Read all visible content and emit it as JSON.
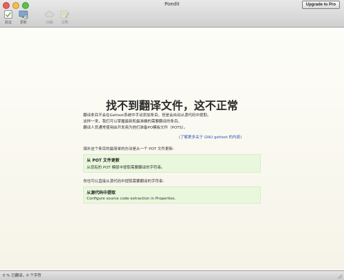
{
  "window": {
    "title": "Poedit",
    "upgrade_label": "Upgrade to Pro"
  },
  "toolbar": {
    "items": [
      {
        "label": "验证",
        "icon": "validate-icon",
        "enabled": true
      },
      {
        "label": "更新",
        "icon": "update-icon",
        "enabled": true
      },
      {
        "label": "同期",
        "icon": "cloud-sync-icon",
        "enabled": false
      },
      {
        "label": "注释",
        "icon": "comment-icon",
        "enabled": false
      }
    ]
  },
  "main": {
    "heading": "找不到翻译文件，这不正常",
    "intro_lines": [
      "翻译条目不会在Gettext系统中手动添加条目。但是会自动从源代码中提取。",
      "这样一来，我们可以掌握最新和最准确的需要翻译的条目。",
      "翻译人员通常使用由开发商为他们准备PO模板文件（POTS）。"
    ],
    "learn_more": "(了解更多关于 GNU gettext 的内容)",
    "para1": "填补这个条目的最简单的办法是从一个 POT 文件更新:",
    "suggestion1": {
      "title": "从 POT 文件更新",
      "desc": "从现有的 POT 模版中提取需要翻译的字符串。"
    },
    "para2": "你也可以直接从源代码中提取需要翻译的字符串:",
    "suggestion2": {
      "title": "从源代码中提取",
      "desc": "Configure source code extraction in Properties."
    }
  },
  "status": {
    "text": "0 % 已翻译，0 个字符"
  },
  "colors": {
    "suggestion_bg": "#e9f7dd",
    "link": "#2a55b8",
    "background": "#fbfaf4"
  }
}
